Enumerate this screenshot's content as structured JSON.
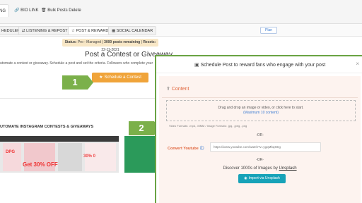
{
  "top_tabs": {
    "partial_tab": "NG",
    "bio_link": "BIO LINK",
    "bulk_delete": "Bulk Posts Delete"
  },
  "sub_tabs": {
    "scheduler": "HEDULER",
    "listening": "LISTENING & REPOST",
    "post_reward": "POST & REWARD",
    "social_calendar": "SOCIAL CALENDAR",
    "plan_button": "Plan"
  },
  "status": {
    "prefix": "Status:",
    "plan": "Pro - Managed",
    "separator1": " | ",
    "remaining": "3000 posts remaining",
    "separator2": " | ",
    "resets_label": "Resets:",
    "resets_date": "22-11-2021"
  },
  "main": {
    "title": "Post a Contest or Giveaway",
    "description": "utomate a contest or giveaway. Schedule a post and set the criteria. Followers who complete your",
    "schedule_button": "Schedule a Contest",
    "auto_section_title": "UTOMATE INSTAGRAM CONTESTS & GIVEAWAYS",
    "thumb_logo": "DPG",
    "thumb_sale": "Get 30% OFF",
    "thumb_pct": "30% 0"
  },
  "steps": {
    "one": "1",
    "two": "2"
  },
  "modal": {
    "title": "Schedule Post to reward fans who engage with your post",
    "close": "×",
    "content_label": "Content",
    "drop_line1": "Drag and drop an image or video, or click here to start.",
    "drop_line2": "(Maximum 10 content)",
    "formats": "Video Formats: .mp4, .MMM / Image Formats: .jpg, .jpeg, .png",
    "or1": "-OR-",
    "convert_label": "Convert Youtube",
    "youtube_placeholder": "https://www.youtube.com/watch?v=ygqMbqSEg",
    "or2": "-OR-",
    "discover_text": "Discover 1000s of Images by",
    "discover_link": "Unsplash",
    "unsplash_button": "Import via Unsplash"
  },
  "colors": {
    "step_green": "#7bb04a",
    "schedule_orange": "#f0a43a",
    "accent_red": "#e0653c",
    "unsplash_teal": "#17a2b8",
    "status_bg": "#f8e7c6"
  },
  "icons": {
    "bio_link": "link-icon",
    "bulk_delete": "trash-icon",
    "listening": "repost-icon",
    "post_reward": "star-icon",
    "social_calendar": "calendar-icon",
    "modal_title": "image-icon",
    "content": "upload-icon",
    "convert_info": "info-icon",
    "unsplash_button": "camera-icon"
  }
}
